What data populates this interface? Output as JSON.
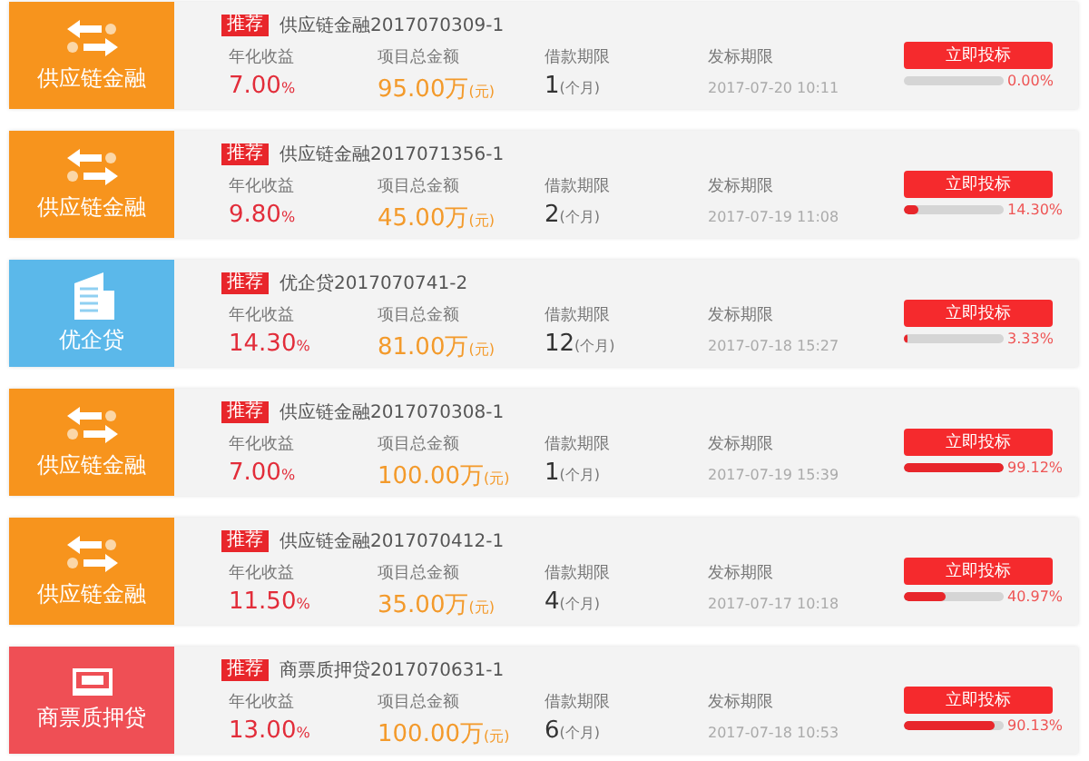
{
  "loans": [
    {
      "kind": "supply",
      "banner_label": "供应链金融",
      "badge": "推荐",
      "title": "供应链金融2017070309-1",
      "rate_label": "年化收益",
      "rate": "7.00",
      "rate_unit": "%",
      "amount_label": "项目总金额",
      "amount": "95.00万",
      "amount_unit": "(元)",
      "term_label": "借款期限",
      "term": "1",
      "term_unit": "(个月)",
      "date_label": "发标期限",
      "date": "2017-07-20 10:11",
      "button": "立即投标",
      "level": 0,
      "percent": "0.00%"
    },
    {
      "kind": "supply",
      "banner_label": "供应链金融",
      "badge": "推荐",
      "title": "供应链金融2017071356-1",
      "rate_label": "年化收益",
      "rate": "9.80",
      "rate_unit": "%",
      "amount_label": "项目总金额",
      "amount": "45.00万",
      "amount_unit": "(元)",
      "term_label": "借款期限",
      "term": "2",
      "term_unit": "(个月)",
      "date_label": "发标期限",
      "date": "2017-07-19 11:08",
      "button": "立即投标",
      "level": 0.143,
      "percent": "14.30%"
    },
    {
      "kind": "enterprise",
      "banner_label": "优企贷",
      "badge": "推荐",
      "title": "优企贷2017070741-2",
      "rate_label": "年化收益",
      "rate": "14.30",
      "rate_unit": "%",
      "amount_label": "项目总金额",
      "amount": "81.00万",
      "amount_unit": "(元)",
      "term_label": "借款期限",
      "term": "12",
      "term_unit": "(个月)",
      "date_label": "发标期限",
      "date": "2017-07-18 15:27",
      "button": "立即投标",
      "level": 0.0333,
      "percent": "3.33%"
    },
    {
      "kind": "supply",
      "banner_label": "供应链金融",
      "badge": "推荐",
      "title": "供应链金融2017070308-1",
      "rate_label": "年化收益",
      "rate": "7.00",
      "rate_unit": "%",
      "amount_label": "项目总金额",
      "amount": "100.00万",
      "amount_unit": "(元)",
      "term_label": "借款期限",
      "term": "1",
      "term_unit": "(个月)",
      "date_label": "发标期限",
      "date": "2017-07-19 15:39",
      "button": "立即投标",
      "level": 0.9912,
      "percent": "99.12%"
    },
    {
      "kind": "supply",
      "banner_label": "供应链金融",
      "badge": "推荐",
      "title": "供应链金融2017070412-1",
      "rate_label": "年化收益",
      "rate": "11.50",
      "rate_unit": "%",
      "amount_label": "项目总金额",
      "amount": "35.00万",
      "amount_unit": "(元)",
      "term_label": "借款期限",
      "term": "4",
      "term_unit": "(个月)",
      "date_label": "发标期限",
      "date": "2017-07-17 10:18",
      "button": "立即投标",
      "level": 0.4097,
      "percent": "40.97%"
    },
    {
      "kind": "bill",
      "banner_label": "商票质押贷",
      "badge": "推荐",
      "title": "商票质押贷2017070631-1",
      "rate_label": "年化收益",
      "rate": "13.00",
      "rate_unit": "%",
      "amount_label": "项目总金额",
      "amount": "100.00万",
      "amount_unit": "(元)",
      "term_label": "借款期限",
      "term": "6",
      "term_unit": "(个月)",
      "date_label": "发标期限",
      "date": "2017-07-18 10:53",
      "button": "立即投标",
      "level": 0.9013,
      "percent": "90.13%"
    }
  ]
}
